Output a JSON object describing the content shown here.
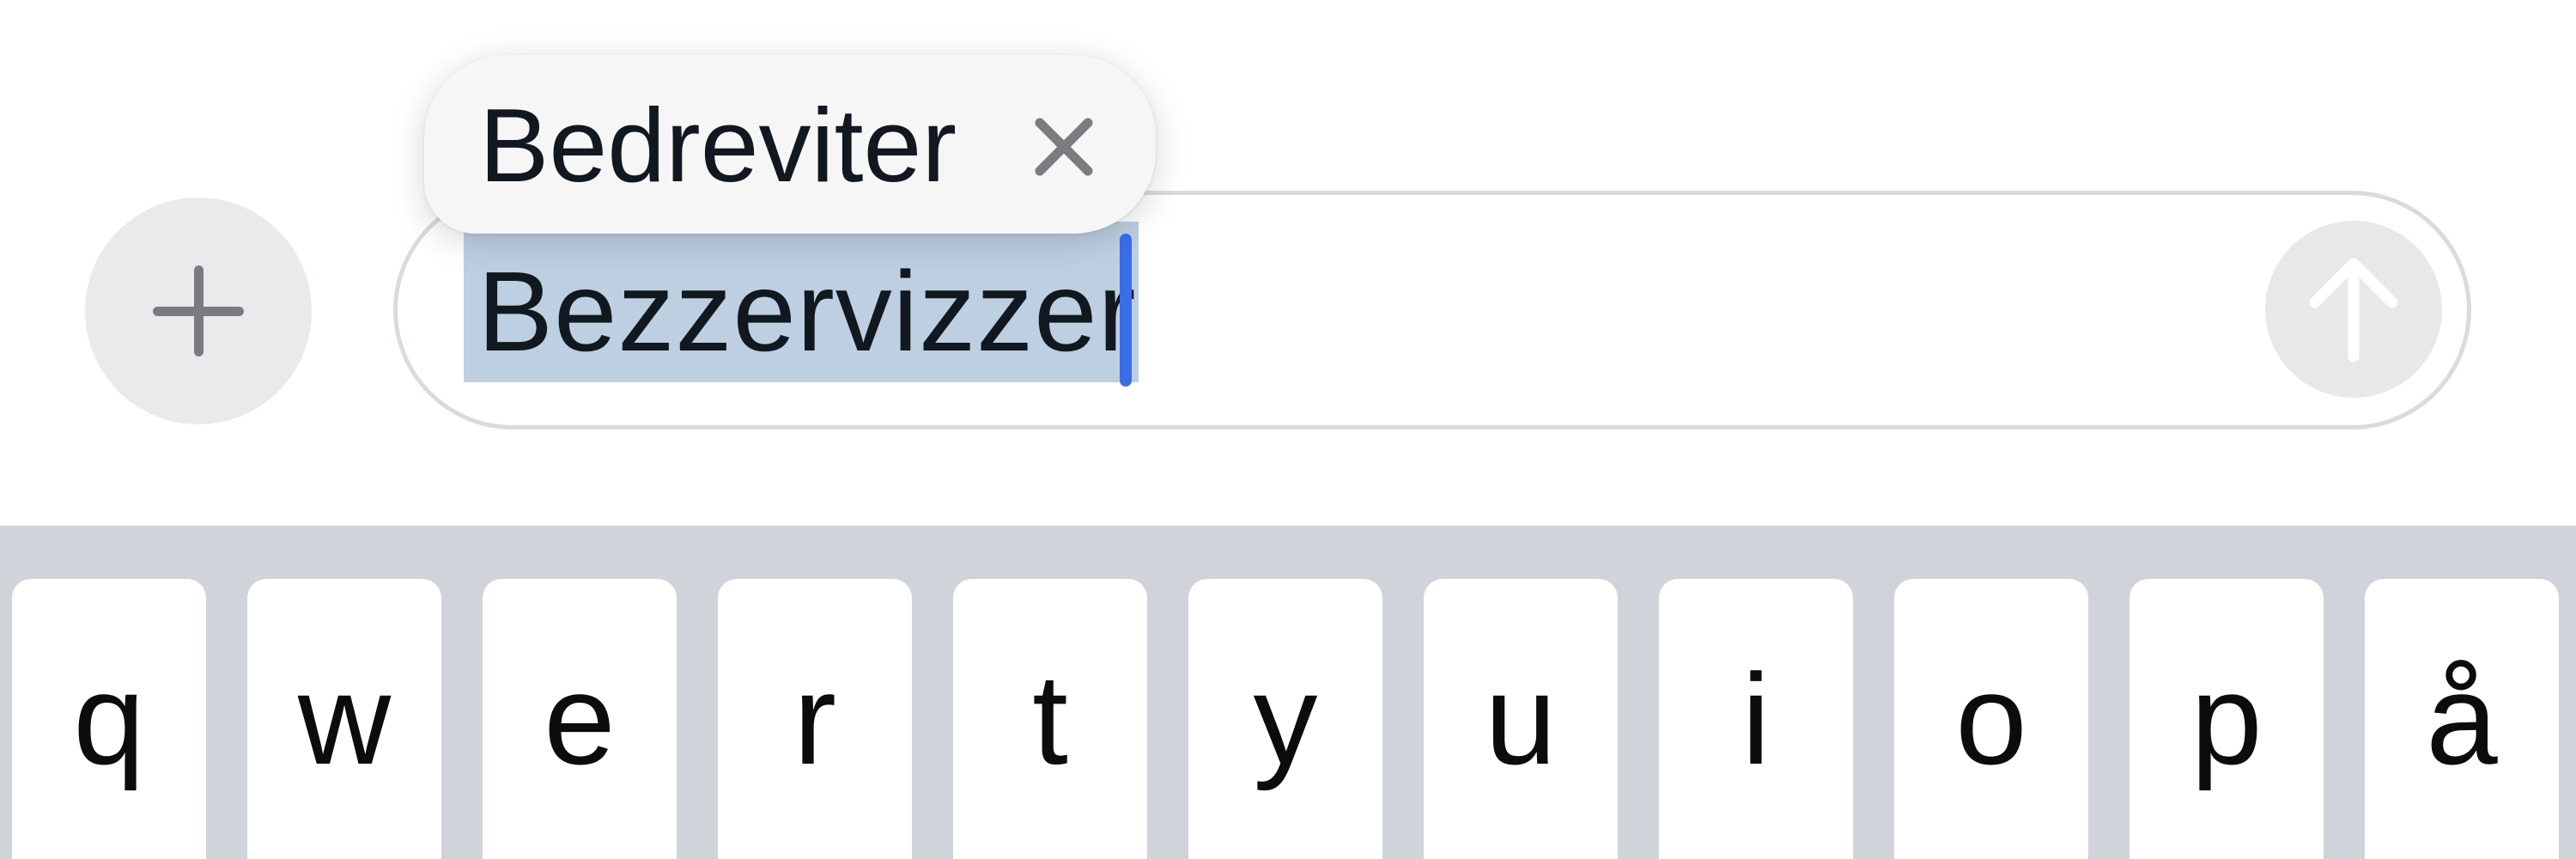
{
  "compose": {
    "text_value": "Bezzervizzer",
    "plus_icon": "plus-icon",
    "send_icon": "arrow-up-icon"
  },
  "autocorrect": {
    "suggestion": "Bedreviter",
    "dismiss_icon": "close-icon"
  },
  "keyboard": {
    "row1": [
      "q",
      "w",
      "e",
      "r",
      "t",
      "y",
      "u",
      "i",
      "o",
      "p",
      "å"
    ]
  },
  "colors": {
    "selection": "#bdcfe1",
    "caret": "#3a6ee8",
    "keyboard_bg": "#d0d3da",
    "button_bg": "#e9eaec"
  }
}
